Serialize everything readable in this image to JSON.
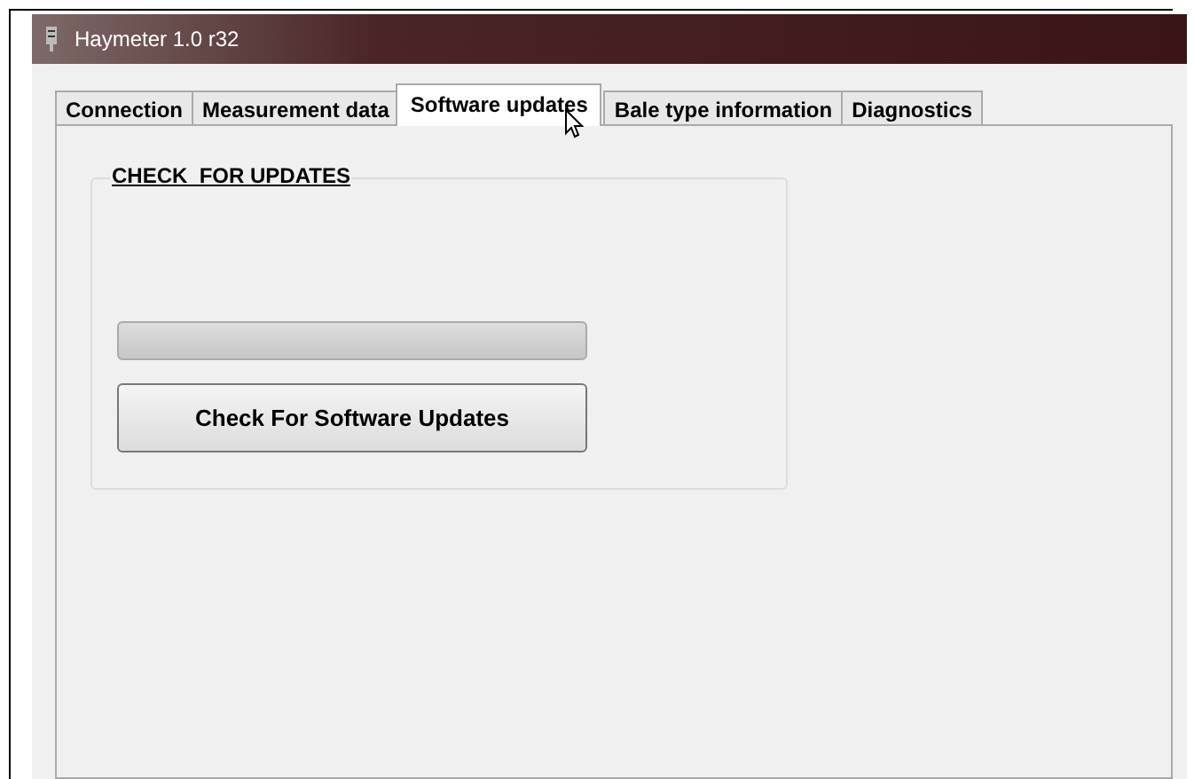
{
  "window": {
    "title": "Haymeter 1.0 r32"
  },
  "tabs": [
    {
      "label": "Connection",
      "selected": false
    },
    {
      "label": "Measurement data",
      "selected": false
    },
    {
      "label": "Software updates",
      "selected": true
    },
    {
      "label": "Bale type information",
      "selected": false
    },
    {
      "label": "Diagnostics",
      "selected": false
    }
  ],
  "group": {
    "title": "CHECK  FOR UPDATES",
    "progress": {
      "level": 0
    },
    "button": "Check For Software Updates"
  }
}
